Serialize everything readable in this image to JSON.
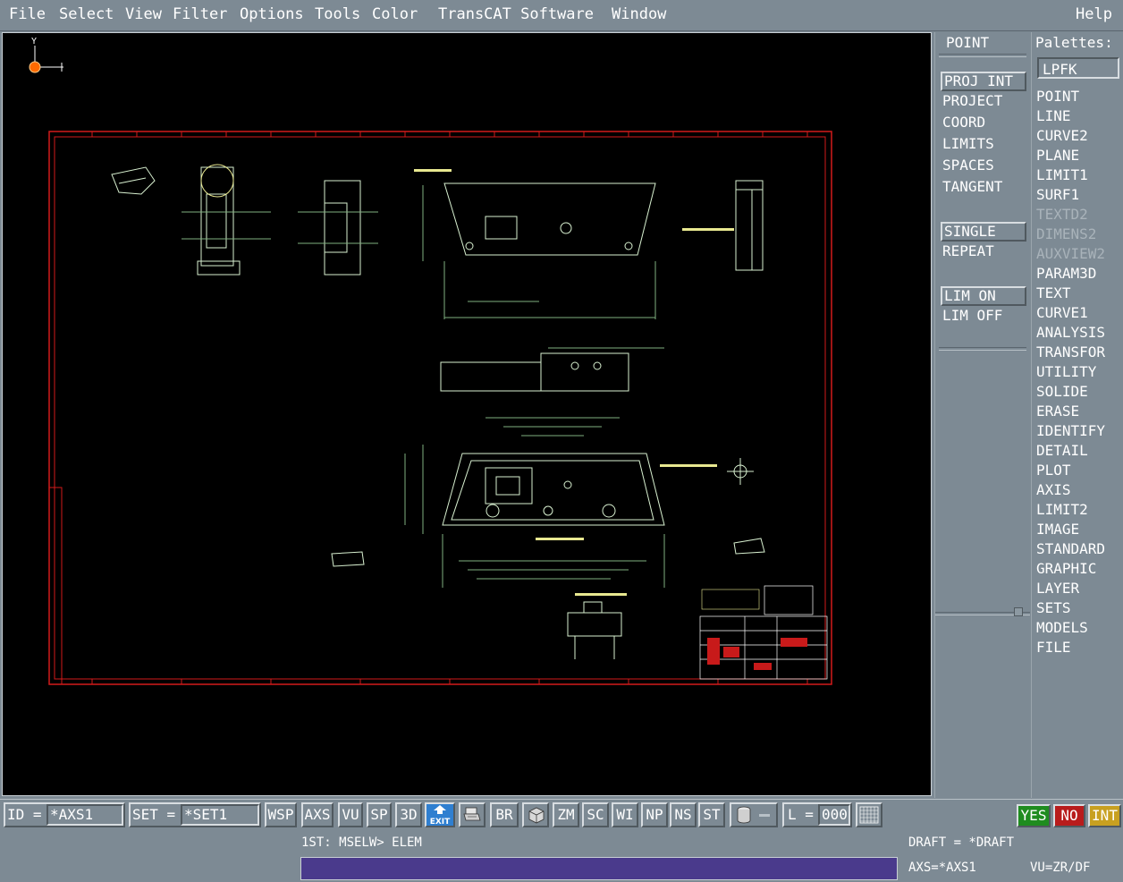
{
  "menubar": {
    "items": [
      "File",
      "Select",
      "View",
      "Filter",
      "Options",
      "Tools",
      "Color",
      "TransCAT Software",
      "Window"
    ],
    "help": "Help"
  },
  "canvas": {
    "axis_label": "Y"
  },
  "options": {
    "title": "POINT",
    "group1": [
      "PROJ INT",
      "PROJECT",
      "COORD",
      "LIMITS",
      "SPACES",
      "TANGENT"
    ],
    "group2": [
      "SINGLE",
      "REPEAT"
    ],
    "group3": [
      "LIM ON",
      "LIM OFF"
    ]
  },
  "palettes": {
    "title": "Palettes:",
    "current": "LPFK",
    "items": [
      "POINT",
      "LINE",
      "CURVE2",
      "PLANE",
      "LIMIT1",
      "SURF1",
      "TEXTD2",
      "DIMENS2",
      "AUXVIEW2",
      "PARAM3D",
      "TEXT",
      "CURVE1",
      "ANALYSIS",
      "TRANSFOR",
      "UTILITY",
      "SOLIDE",
      "ERASE",
      "IDENTIFY",
      "DETAIL",
      "PLOT",
      "AXIS",
      "LIMIT2",
      "IMAGE",
      "STANDARD",
      "GRAPHIC",
      "LAYER",
      "SETS",
      "MODELS",
      "FILE"
    ],
    "disabled": [
      "TEXTD2",
      "DIMENS2",
      "AUXVIEW2"
    ]
  },
  "toolbar": {
    "id_label": "ID =",
    "id_value": "*AXS1",
    "set_label": "SET =",
    "set_value": "*SET1",
    "buttons": [
      "WSP",
      "AXS",
      "VU",
      "SP",
      "3D"
    ],
    "exit_label": "EXIT",
    "buttons2": [
      "BR"
    ],
    "buttons3": [
      "ZM",
      "SC",
      "WI",
      "NP",
      "NS",
      "ST"
    ],
    "l_label": "L =",
    "l_value": "000",
    "yes": "YES",
    "no": "NO",
    "int": "INT"
  },
  "colors": {
    "yes": "#1f8c1f",
    "no": "#b81c1c",
    "int": "#c8a020",
    "command_input": "#4a3a8c"
  },
  "status": {
    "prompt": "1ST: MSELW> ELEM",
    "draft": "DRAFT = *DRAFT",
    "axs": "AXS=*AXS1",
    "vu": "VU=ZR/DF"
  }
}
